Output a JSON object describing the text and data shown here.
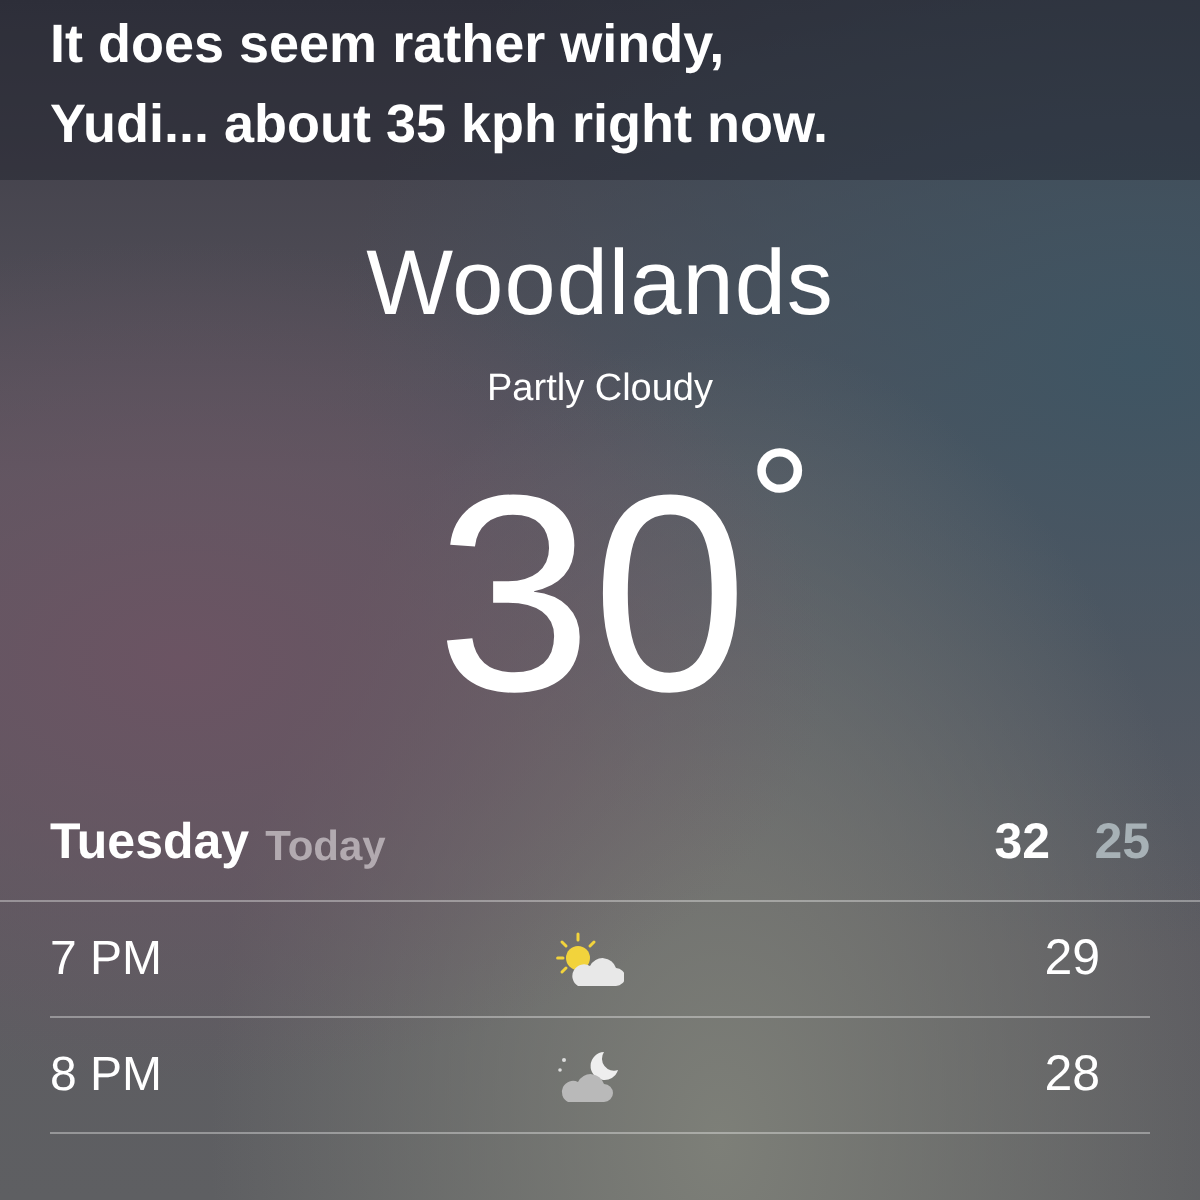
{
  "siri_response": [
    "It does seem rather windy,",
    "Yudi... about 35 kph right now."
  ],
  "weather": {
    "city": "Woodlands",
    "condition": "Partly Cloudy",
    "temperature": "30",
    "degree": "°",
    "day": {
      "name": "Tuesday",
      "label": "Today",
      "high": "32",
      "low": "25"
    },
    "hours": [
      {
        "time": "7 PM",
        "kind": "sun-cloud",
        "temp": "29"
      },
      {
        "time": "8 PM",
        "kind": "moon-cloud",
        "temp": "28"
      }
    ]
  }
}
